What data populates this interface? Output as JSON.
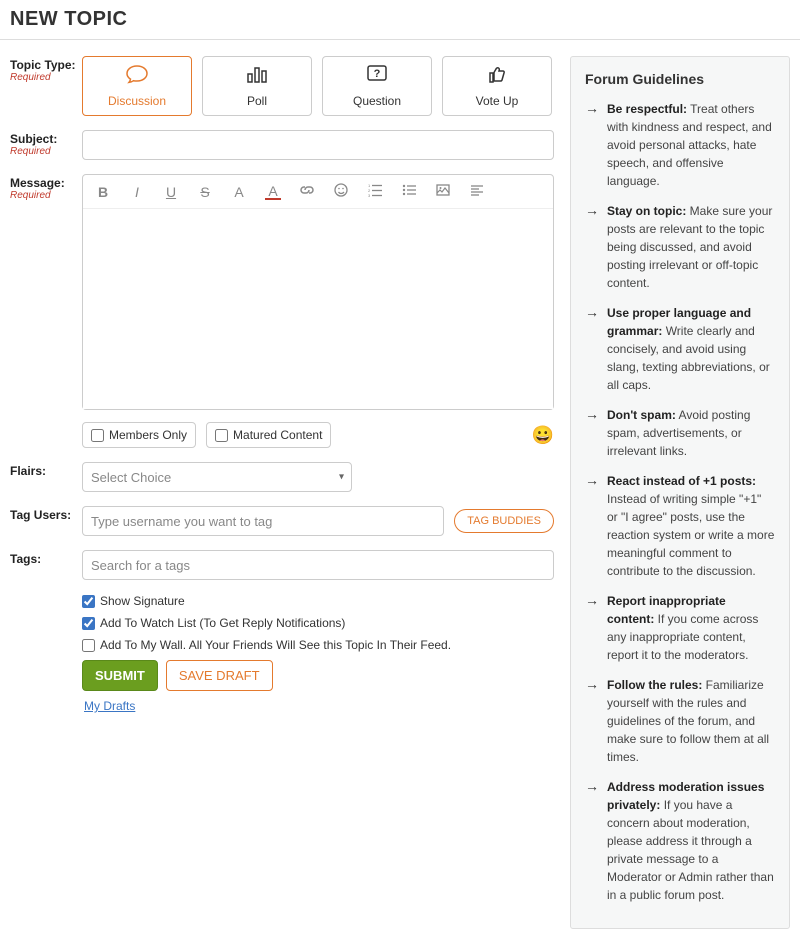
{
  "pageTitle": "NEW TOPIC",
  "labels": {
    "topicType": "Topic Type:",
    "subject": "Subject:",
    "message": "Message:",
    "flairs": "Flairs:",
    "tagUsers": "Tag Users:",
    "tags": "Tags:",
    "required": "Required"
  },
  "topicTypes": {
    "discussion": "Discussion",
    "poll": "Poll",
    "question": "Question",
    "voteup": "Vote Up"
  },
  "contentFlags": {
    "membersOnly": "Members Only",
    "maturedContent": "Matured Content"
  },
  "flairsSelect": {
    "placeholder": "Select Choice"
  },
  "tagUsers": {
    "placeholder": "Type username you want to tag",
    "buddiesButton": "TAG BUDDIES"
  },
  "tagsInput": {
    "placeholder": "Search for a tags"
  },
  "checkboxes": {
    "showSignature": "Show Signature",
    "watchList": "Add To Watch List (To Get Reply Notifications)",
    "addToWall": "Add To My Wall. All Your Friends Will See this Topic In Their Feed."
  },
  "buttons": {
    "submit": "SUBMIT",
    "saveDraft": "SAVE DRAFT"
  },
  "draftsLink": "My Drafts",
  "guidelines": {
    "title": "Forum Guidelines",
    "items": [
      {
        "bold": "Be respectful:",
        "text": " Treat others with kindness and respect, and avoid personal attacks, hate speech, and offensive language."
      },
      {
        "bold": "Stay on topic:",
        "text": " Make sure your posts are relevant to the topic being discussed, and avoid posting irrelevant or off-topic content."
      },
      {
        "bold": "Use proper language and grammar:",
        "text": " Write clearly and concisely, and avoid using slang, texting abbreviations, or all caps."
      },
      {
        "bold": "Don't spam:",
        "text": " Avoid posting spam, advertisements, or irrelevant links."
      },
      {
        "bold": "React instead of +1 posts:",
        "text": " Instead of writing simple \"+1\" or \"I agree\" posts, use the reaction system or write a more meaningful comment to contribute to the discussion."
      },
      {
        "bold": "Report inappropriate content:",
        "text": " If you come across any inappropriate content, report it to the moderators."
      },
      {
        "bold": "Follow the rules:",
        "text": " Familiarize yourself with the rules and guidelines of the forum, and make sure to follow them at all times."
      },
      {
        "bold": "Address moderation issues privately:",
        "text": " If you have a concern about moderation, please address it through a private message to a Moderator or Admin rather than in a public forum post."
      }
    ]
  }
}
